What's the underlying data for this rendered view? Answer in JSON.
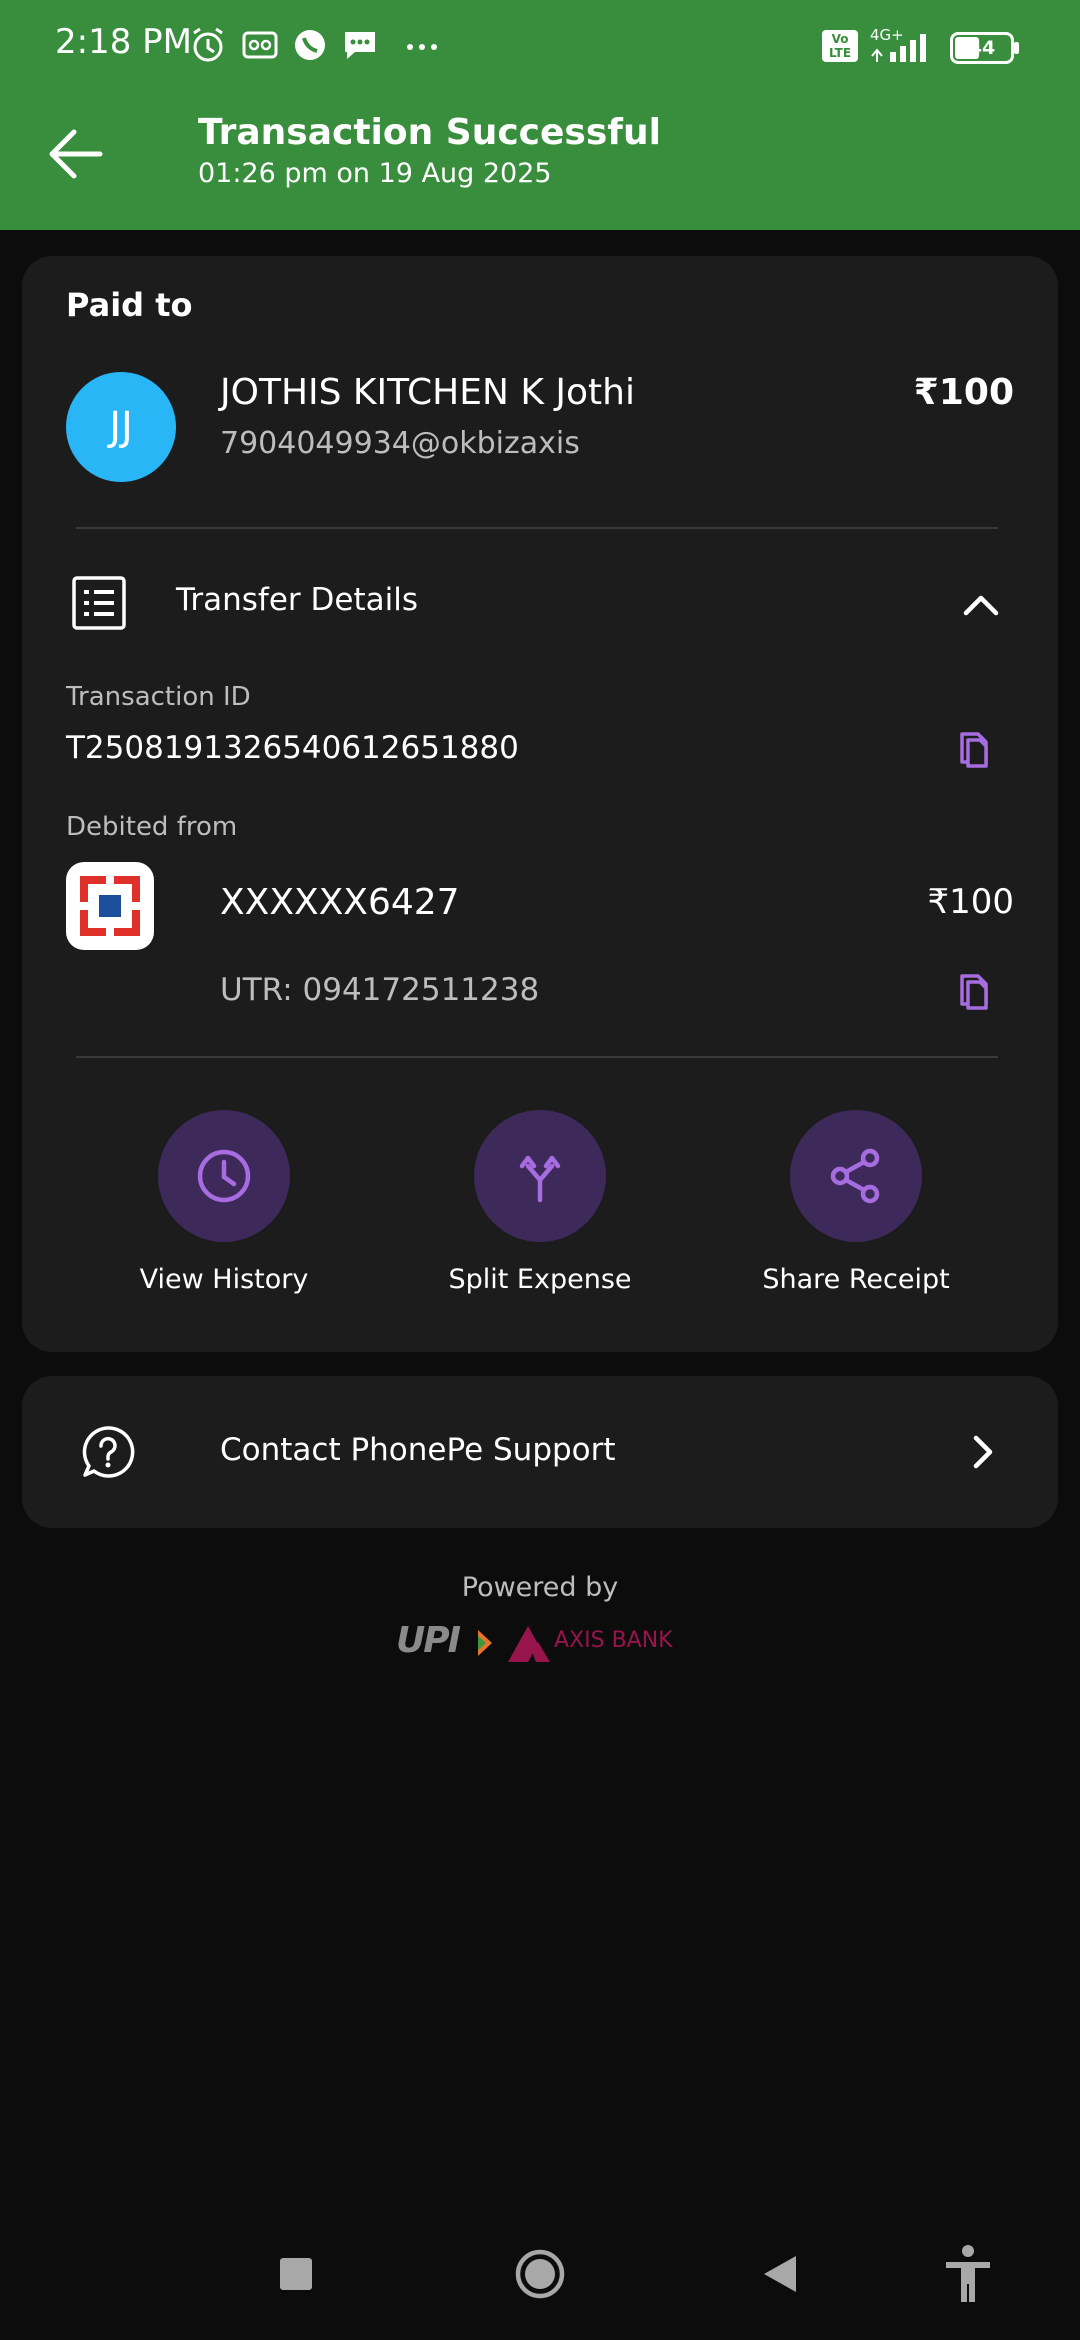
{
  "status_bar": {
    "time": "2:18 PM",
    "battery": "44",
    "network": "4G+",
    "volte": "Vo LTE"
  },
  "header": {
    "title": "Transaction Successful",
    "subtitle": "01:26 pm on 19 Aug 2025"
  },
  "payment": {
    "paid_to_label": "Paid to",
    "avatar_initials": "JJ",
    "payee_name": "JOTHIS KITCHEN K Jothi",
    "payee_upi": "7904049934@okbizaxis",
    "amount": "₹100"
  },
  "transfer_details": {
    "title": "Transfer Details",
    "transaction_id_label": "Transaction ID",
    "transaction_id": "T2508191326540612651880",
    "debited_from_label": "Debited from",
    "account": "XXXXXX6427",
    "debit_amount": "₹100",
    "utr": "UTR: 094172511238"
  },
  "actions": [
    {
      "label": "View History",
      "icon": "clock-icon"
    },
    {
      "label": "Split Expense",
      "icon": "split-icon"
    },
    {
      "label": "Share Receipt",
      "icon": "share-icon"
    }
  ],
  "support": {
    "label": "Contact PhonePe Support"
  },
  "footer": {
    "powered_by": "Powered by",
    "upi_logo_text": "UPI",
    "bank_logo_text": "AXIS BANK"
  },
  "colors": {
    "header_green": "#388e3c",
    "card_bg": "#1c1c1d",
    "accent_purple": "#a76ce0",
    "avatar_blue": "#29b6f6"
  }
}
